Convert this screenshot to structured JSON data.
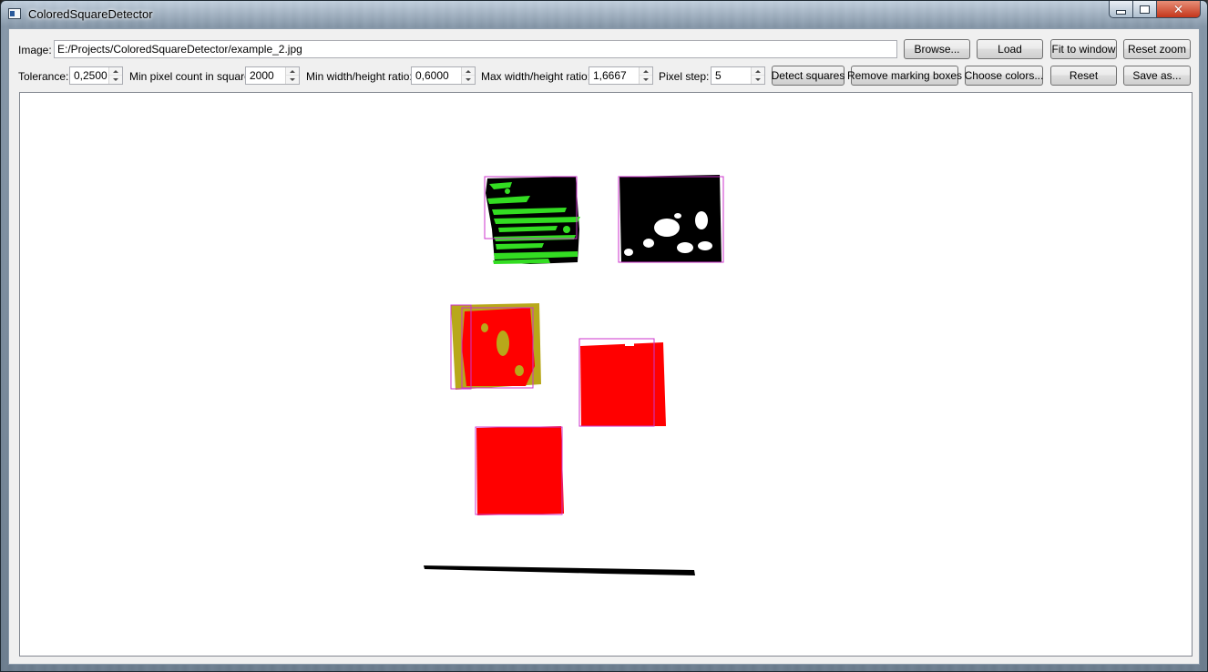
{
  "window": {
    "title": "ColoredSquareDetector"
  },
  "toolbar": {
    "image_label": "Image:",
    "image_path": "E:/Projects/ColoredSquareDetector/example_2.jpg",
    "browse": "Browse...",
    "load": "Load",
    "fit": "Fit to window",
    "reset_zoom": "Reset zoom"
  },
  "params": {
    "tolerance_label": "Tolerance:",
    "tolerance": "0,2500",
    "min_pixel_label": "Min pixel count in square:",
    "min_pixel": "2000",
    "min_ratio_label": "Min width/height ratio:",
    "min_ratio": "0,6000",
    "max_ratio_label": "Max width/height ratio:",
    "max_ratio": "1,6667",
    "pixel_step_label": "Pixel step:",
    "pixel_step": "5",
    "detect": "Detect squares",
    "remove_boxes": "Remove marking boxes",
    "choose_colors": "Choose colors...",
    "reset": "Reset",
    "save_as": "Save as..."
  },
  "colors": {
    "box_outline": "#cc33cc",
    "red": "#ff0000",
    "green": "#33dd22",
    "olive": "#b8a81a",
    "black": "#000000"
  }
}
